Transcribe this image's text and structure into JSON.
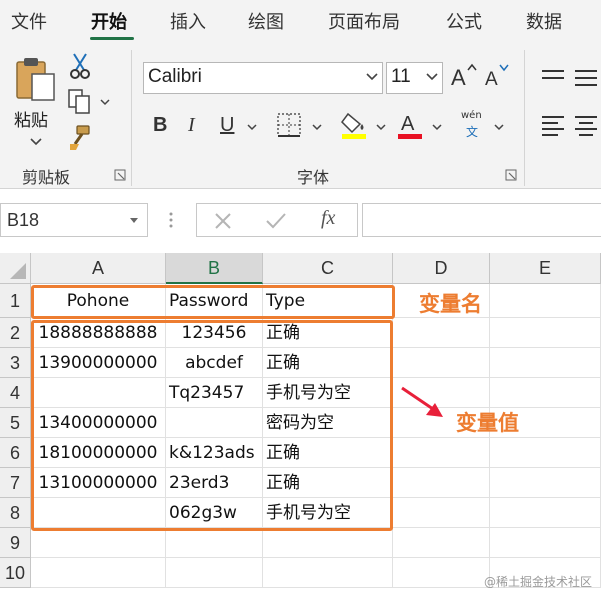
{
  "ribbon_tabs": [
    "文件",
    "开始",
    "插入",
    "绘图",
    "页面布局",
    "公式",
    "数据"
  ],
  "active_tab": "开始",
  "clipboard": {
    "paste_label": "粘贴",
    "group_label": "剪贴板"
  },
  "font_group": {
    "font_name": "Calibri",
    "font_size": "11",
    "bold_label": "B",
    "italic_label": "I",
    "underline_label": "U",
    "phonetic_top": "wén",
    "phonetic_bottom": "文",
    "group_label": "字体",
    "font_color": "#e81123",
    "highlight_color": "#ffff00"
  },
  "formula_bar": {
    "name_box": "B18",
    "fx_label": "fx",
    "formula": ""
  },
  "sheet": {
    "columns": [
      "A",
      "B",
      "C",
      "D",
      "E"
    ],
    "selected_column": "B",
    "rows": [
      "1",
      "2",
      "3",
      "4",
      "5",
      "6",
      "7",
      "8",
      "9",
      "10"
    ],
    "header": [
      "Pohone",
      "Password",
      "Type"
    ],
    "data": [
      [
        "18888888888",
        "123456",
        "正确"
      ],
      [
        "13900000000",
        "abcdef",
        "正确"
      ],
      [
        "",
        "Tq23457",
        "手机号为空"
      ],
      [
        "13400000000",
        "",
        "密码为空"
      ],
      [
        "18100000000",
        "k&123ads",
        "正确"
      ],
      [
        "13100000000",
        "23erd3",
        "正确"
      ],
      [
        "",
        "062g3w",
        "手机号为空"
      ]
    ]
  },
  "annotations": {
    "var_name": "变量名",
    "var_value": "变量值",
    "color": "#ed7d31",
    "arrow_color": "#e8203a"
  },
  "watermark": "@稀土掘金技术社区"
}
